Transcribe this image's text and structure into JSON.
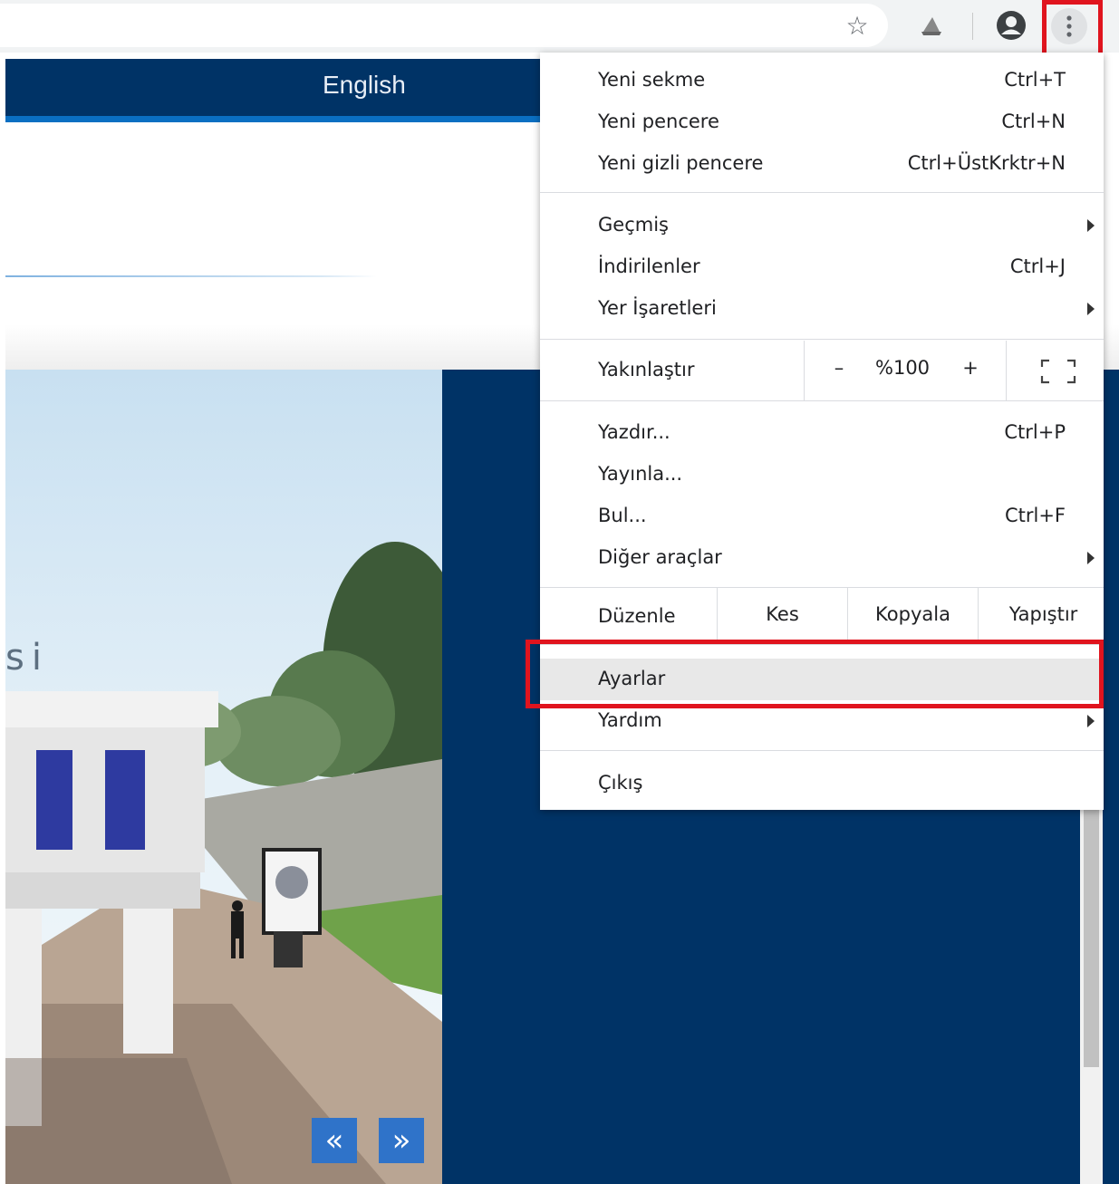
{
  "toolbar": {
    "star_icon": "☆",
    "extension_icon": "⛅",
    "profile_icon": "●",
    "menu_icon": "⋮"
  },
  "site": {
    "nav_language": "English",
    "photo_text": "si",
    "slider_prev": "«",
    "slider_next": "»"
  },
  "menu": {
    "new_tab": {
      "label": "Yeni sekme",
      "shortcut": "Ctrl+T"
    },
    "new_window": {
      "label": "Yeni pencere",
      "shortcut": "Ctrl+N"
    },
    "incognito": {
      "label": "Yeni gizli pencere",
      "shortcut": "Ctrl+ÜstKrktr+N"
    },
    "history": {
      "label": "Geçmiş"
    },
    "downloads": {
      "label": "İndirilenler",
      "shortcut": "Ctrl+J"
    },
    "bookmarks": {
      "label": "Yer İşaretleri"
    },
    "zoom": {
      "label": "Yakınlaştır",
      "minus": "–",
      "value": "%100",
      "plus": "+"
    },
    "print": {
      "label": "Yazdır...",
      "shortcut": "Ctrl+P"
    },
    "cast": {
      "label": "Yayınla..."
    },
    "find": {
      "label": "Bul...",
      "shortcut": "Ctrl+F"
    },
    "more_tools": {
      "label": "Diğer araçlar"
    },
    "edit": {
      "label": "Düzenle",
      "cut": "Kes",
      "copy": "Kopyala",
      "paste": "Yapıştır"
    },
    "settings": {
      "label": "Ayarlar"
    },
    "help": {
      "label": "Yardım"
    },
    "exit": {
      "label": "Çıkış"
    }
  },
  "colors": {
    "highlight_box": "#e0141e",
    "site_navy": "#003366",
    "slider_blue": "#2f73c9"
  }
}
